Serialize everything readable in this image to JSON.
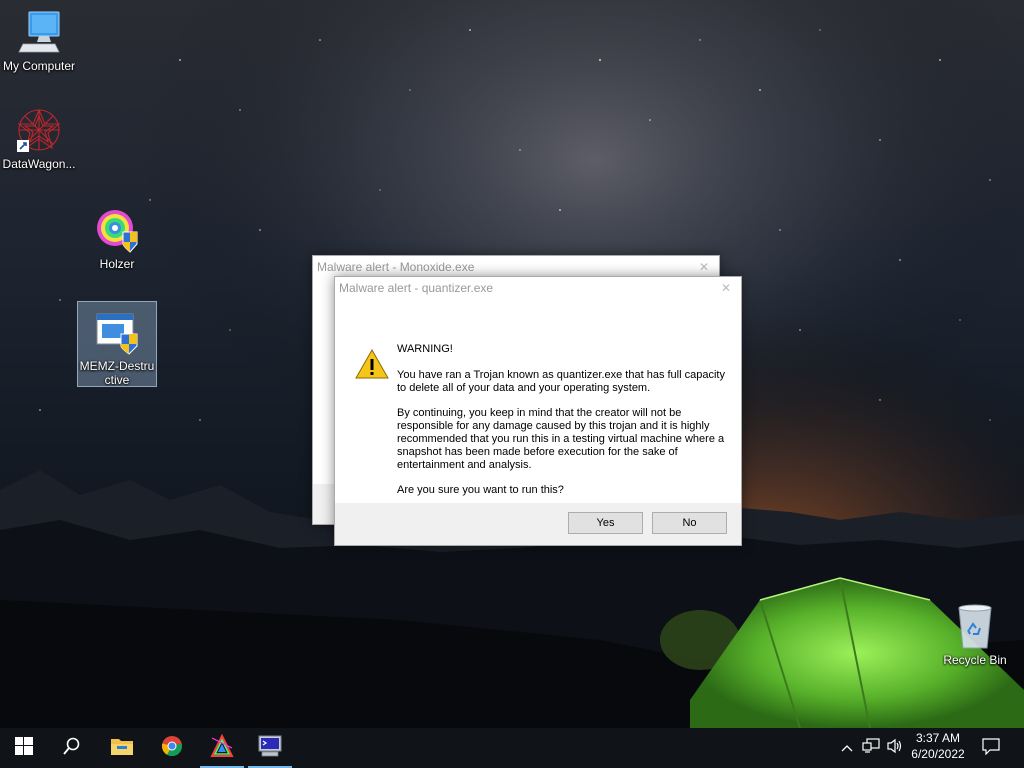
{
  "desktop": {
    "icons": [
      {
        "label": "My Computer",
        "icon": "computer-icon"
      },
      {
        "label": "DataWagon...",
        "icon": "datawagon-icon"
      },
      {
        "label": "Holzer",
        "icon": "holzer-icon"
      },
      {
        "label": "MEMZ-Destru ctive",
        "icon": "memz-icon",
        "selected": true
      }
    ],
    "recycle_bin": {
      "label": "Recycle Bin",
      "icon": "recycle-bin-icon"
    }
  },
  "dialogs": {
    "back": {
      "title": "Malware alert - Monoxide.exe",
      "close_glyph": "✕"
    },
    "front": {
      "title": "Malware alert - quantizer.exe",
      "close_glyph": "✕",
      "icon": "warning-icon",
      "heading": "WARNING!",
      "paragraph1": "You have ran a Trojan known as quantizer.exe that has full capacity to delete all of your data and your operating system.",
      "paragraph2": "By continuing, you keep in mind that the creator will not be responsible for any damage caused by this trojan and it is highly recommended that you run this in a testing virtual machine where a snapshot has been made before execution for the sake of entertainment and analysis.",
      "question": "Are you sure you want to run this?",
      "yes_label": "Yes",
      "no_label": "No"
    }
  },
  "taskbar": {
    "items": [
      {
        "name": "start-button",
        "icon": "windows-icon"
      },
      {
        "name": "search-button",
        "icon": "search-icon"
      },
      {
        "name": "file-explorer",
        "icon": "folder-icon"
      },
      {
        "name": "chrome",
        "icon": "chrome-icon"
      },
      {
        "name": "app-colorful",
        "icon": "colorful-app-icon",
        "active": true
      },
      {
        "name": "app-terminal",
        "icon": "terminal-app-icon",
        "active": true
      }
    ],
    "tray": {
      "time": "3:37 AM",
      "date": "6/20/2022"
    },
    "accent": "#76b9ed"
  }
}
